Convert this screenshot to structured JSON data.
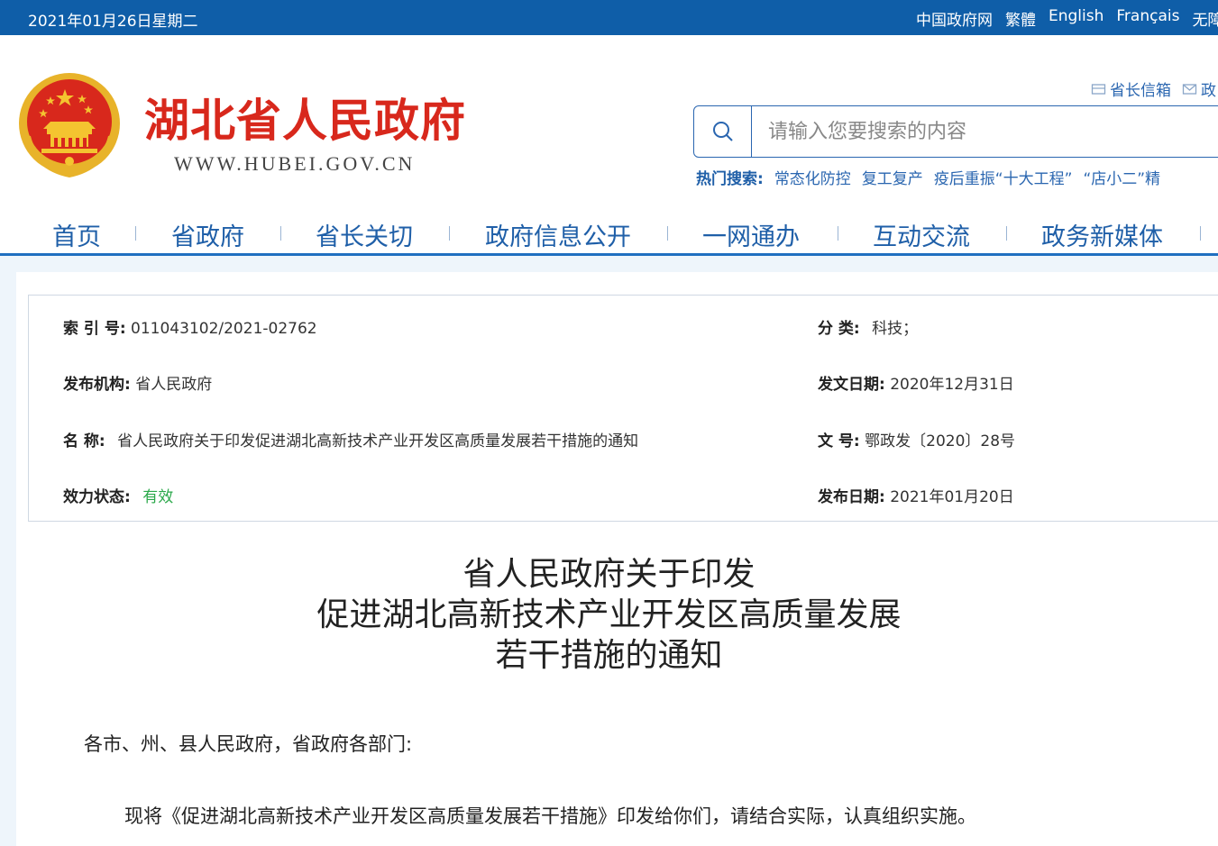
{
  "topbar": {
    "date": "2021年01月26日星期二",
    "links": [
      "中国政府网",
      "繁體",
      "English",
      "Français",
      "无障"
    ]
  },
  "header": {
    "title": "湖北省人民政府",
    "url": "WWW.HUBEI.GOV.CN",
    "emblem_icon": "national-emblem-icon",
    "tool_links": [
      "省长信箱",
      "政"
    ],
    "search": {
      "placeholder": "请输入您要搜索的内容"
    },
    "hot_search": {
      "label": "热门搜索:",
      "keywords": [
        "常态化防控",
        "复工复产",
        "疫后重振“十大工程”",
        "“店小二”精"
      ]
    }
  },
  "nav": {
    "items": [
      "首页",
      "省政府",
      "省长关切",
      "政府信息公开",
      "一网通办",
      "互动交流",
      "政务新媒体"
    ]
  },
  "meta": {
    "index_label": "索 引 号:",
    "index_value": "011043102/2021-02762",
    "category_label": "分 类:",
    "category_value": "科技；",
    "publisher_label": "发布机构:",
    "publisher_value": "省人民政府",
    "issue_date_label": "发文日期:",
    "issue_date_value": "2020年12月31日",
    "name_label": "名 称:",
    "name_value": "省人民政府关于印发促进湖北高新技术产业开发区高质量发展若干措施的通知",
    "doc_no_label": "文 号:",
    "doc_no_value": "鄂政发〔2020〕28号",
    "status_label": "效力状态:",
    "status_value": "有效",
    "publish_date_label": "发布日期:",
    "publish_date_value": "2021年01月20日"
  },
  "document": {
    "title_lines": [
      "省人民政府关于印发",
      "促进湖北高新技术产业开发区高质量发展",
      "若干措施的通知"
    ],
    "salutation": "各市、州、县人民政府，省政府各部门:",
    "body": "现将《促进湖北高新技术产业开发区高质量发展若干措施》印发给你们，请结合实际，认真组织实施。"
  },
  "colors": {
    "topbar": "#0f5ea8",
    "brand_red": "#d8281c",
    "nav_blue": "#1f5fa8",
    "valid_green": "#2aa84a"
  }
}
